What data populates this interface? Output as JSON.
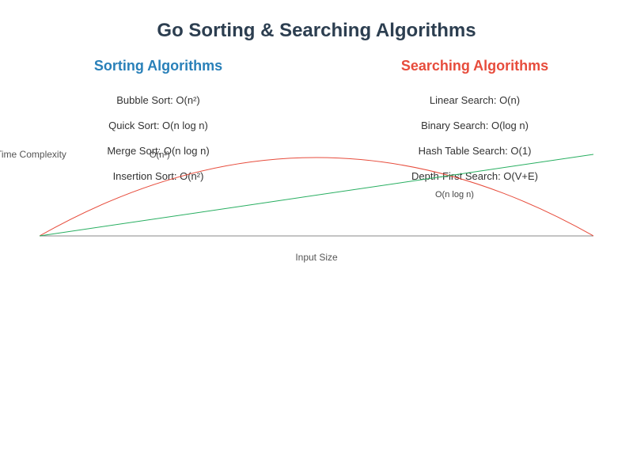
{
  "title": "Go Sorting & Searching Algorithms",
  "sections": {
    "sorting": {
      "title": "Sorting Algorithms",
      "items": [
        "Bubble Sort: O(n²)",
        "Quick Sort: O(n log n)",
        "Merge Sort: O(n log n)",
        "Insertion Sort: O(n²)"
      ]
    },
    "searching": {
      "title": "Searching Algorithms",
      "items": [
        "Linear Search: O(n)",
        "Binary Search: O(log n)",
        "Hash Table Search: O(1)",
        "Depth-First Search: O(V+E)"
      ]
    }
  },
  "axes": {
    "x": "Input Size",
    "y": "Time Complexity"
  },
  "curve_labels": {
    "on2": "O(n²)",
    "onlogn": "O(n log n)"
  },
  "chart_data": {
    "type": "line",
    "title": "Go Sorting & Searching Algorithms",
    "xlabel": "Input Size",
    "ylabel": "Time Complexity",
    "series": [
      {
        "name": "O(n²)",
        "description": "Quadratic growth curve (red)",
        "color": "#e74c3c"
      },
      {
        "name": "O(n log n)",
        "description": "Near-linear growth curve (green)",
        "color": "#27ae60"
      }
    ],
    "note": "Conceptual complexity curves; no numeric axis ticks shown"
  }
}
